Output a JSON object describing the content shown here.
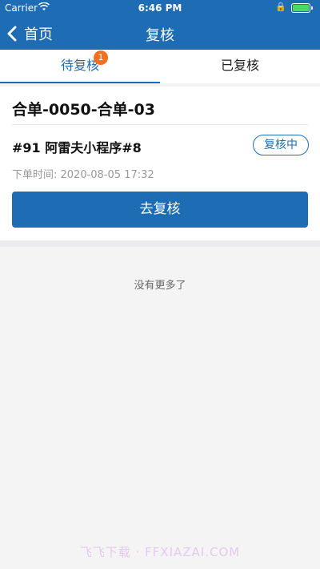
{
  "status_bar": {
    "carrier": "Carrier",
    "time": "6:46 PM"
  },
  "navbar": {
    "back_label": "首页",
    "title": "复核"
  },
  "tabs": [
    {
      "label": "待复核",
      "badge": "1",
      "active": true
    },
    {
      "label": "已复核",
      "active": false
    }
  ],
  "order": {
    "title": "合单-0050-合单-03",
    "shop": "#91 阿雷夫小程序#8",
    "status": "复核中",
    "time": "下单时间: 2020-08-05 17:32",
    "action_label": "去复核"
  },
  "list_footer": "没有更多了",
  "watermark": "飞飞下载 · FFXIAZAI.COM",
  "colors": {
    "primary": "#1e6db4",
    "badge": "#f37021"
  }
}
